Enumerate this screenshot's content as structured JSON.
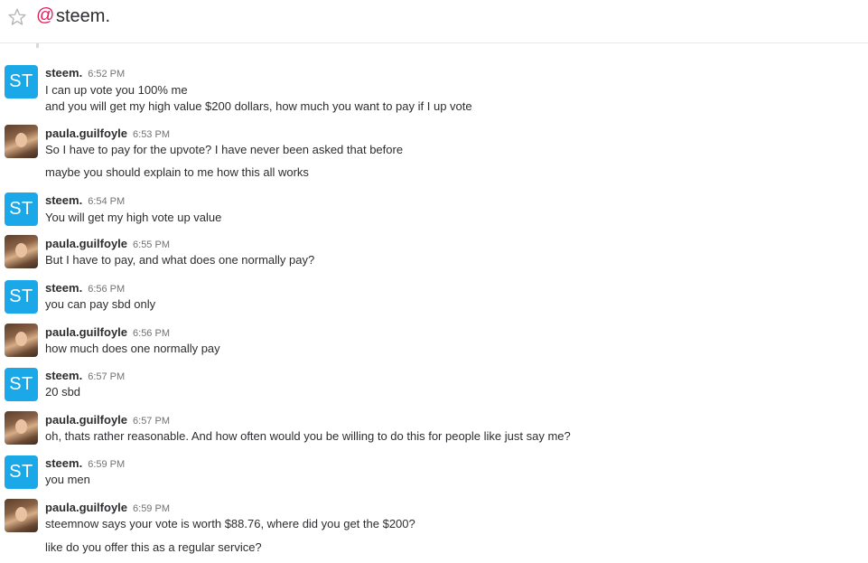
{
  "header": {
    "channel": "steem.",
    "at": "@"
  },
  "messages": [
    {
      "author": "steem.",
      "time": "6:52 PM",
      "avatar": "ST",
      "avatar_type": "steem",
      "lines": [
        "I can up vote you 100% me",
        "and you will get my high value $200 dollars, how much you want to pay if I up vote"
      ]
    },
    {
      "author": "paula.guilfoyle",
      "time": "6:53 PM",
      "avatar_type": "photo",
      "lines": [
        "So I have to pay for the upvote? I have never been asked that before",
        "maybe you should explain to me how this all works"
      ]
    },
    {
      "author": "steem.",
      "time": "6:54 PM",
      "avatar": "ST",
      "avatar_type": "steem",
      "lines": [
        "You will get my high vote up value"
      ]
    },
    {
      "author": "paula.guilfoyle",
      "time": "6:55 PM",
      "avatar_type": "photo",
      "lines": [
        "But I have to pay, and what does one normally pay?"
      ]
    },
    {
      "author": "steem.",
      "time": "6:56 PM",
      "avatar": "ST",
      "avatar_type": "steem",
      "lines": [
        "you can pay sbd only"
      ]
    },
    {
      "author": "paula.guilfoyle",
      "time": "6:56 PM",
      "avatar_type": "photo",
      "lines": [
        "how much does one normally pay"
      ]
    },
    {
      "author": "steem.",
      "time": "6:57 PM",
      "avatar": "ST",
      "avatar_type": "steem",
      "lines": [
        "20 sbd"
      ]
    },
    {
      "author": "paula.guilfoyle",
      "time": "6:57 PM",
      "avatar_type": "photo",
      "lines": [
        "oh, thats rather reasonable. And how often would you be willing to do this for people like just say me?"
      ]
    },
    {
      "author": "steem.",
      "time": "6:59 PM",
      "avatar": "ST",
      "avatar_type": "steem",
      "lines": [
        "you men"
      ]
    },
    {
      "author": "paula.guilfoyle",
      "time": "6:59 PM",
      "avatar_type": "photo",
      "lines": [
        "steemnow says your vote is worth $88.76, where did you get the $200?",
        "like do you offer this as a regular service?"
      ]
    }
  ],
  "colors": {
    "steem_avatar": "#1aa8e8",
    "mention_accent": "#e01e5a"
  }
}
